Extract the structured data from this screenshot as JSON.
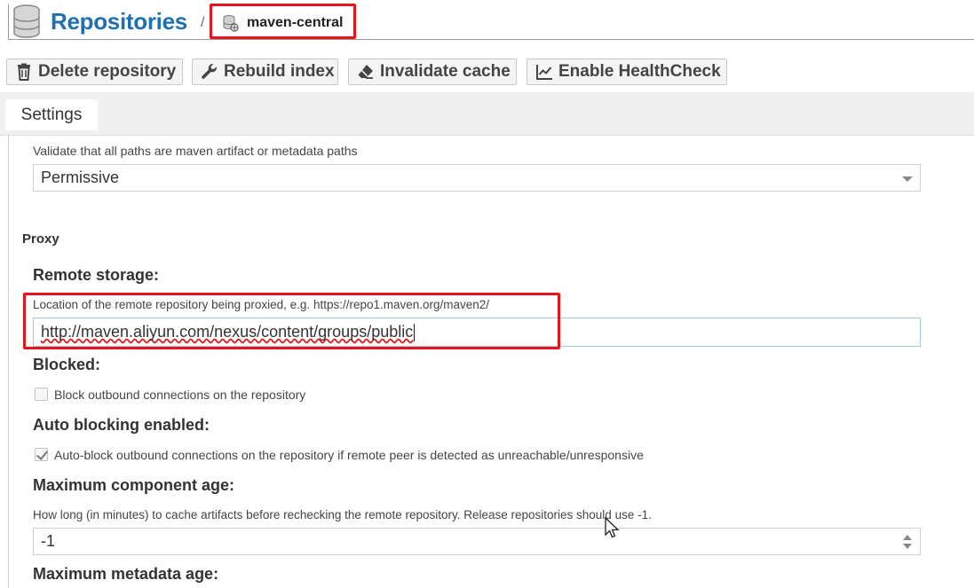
{
  "header": {
    "title": "Repositories",
    "separator": "/",
    "breadcrumb_current": "maven-central"
  },
  "toolbar": {
    "delete_label": "Delete repository",
    "rebuild_label": "Rebuild index",
    "invalidate_label": "Invalidate cache",
    "healthcheck_label": "Enable HealthCheck"
  },
  "tabs": [
    {
      "label": "Settings"
    }
  ],
  "form": {
    "validation_help": "Validate that all paths are maven artifact or metadata paths",
    "validation_value": "Permissive",
    "proxy_section": "Proxy",
    "remote_storage_label": "Remote storage:",
    "remote_storage_help": "Location of the remote repository being proxied, e.g. https://repo1.maven.org/maven2/",
    "remote_storage_value": "http://maven.aliyun.com/nexus/content/groups/public",
    "blocked_label": "Blocked:",
    "blocked_checkbox_label": "Block outbound connections on the repository",
    "blocked_checked": false,
    "auto_blocking_label": "Auto blocking enabled:",
    "auto_blocking_checkbox_label": "Auto-block outbound connections on the repository if remote peer is detected as unreachable/unresponsive",
    "auto_blocking_checked": true,
    "max_component_age_label": "Maximum component age:",
    "max_component_age_help": "How long (in minutes) to cache artifacts before rechecking the remote repository. Release repositories should use -1.",
    "max_component_age_value": "-1",
    "max_metadata_age_label": "Maximum metadata age:"
  },
  "colors": {
    "title_blue": "#1f6fb5",
    "highlight_red": "#e8141b"
  },
  "icons": {
    "title": "database-icon",
    "breadcrumb": "proxy-repository-icon",
    "delete": "trash-icon",
    "rebuild": "wrench-icon",
    "invalidate": "eraser-icon",
    "healthcheck": "line-chart-icon"
  }
}
